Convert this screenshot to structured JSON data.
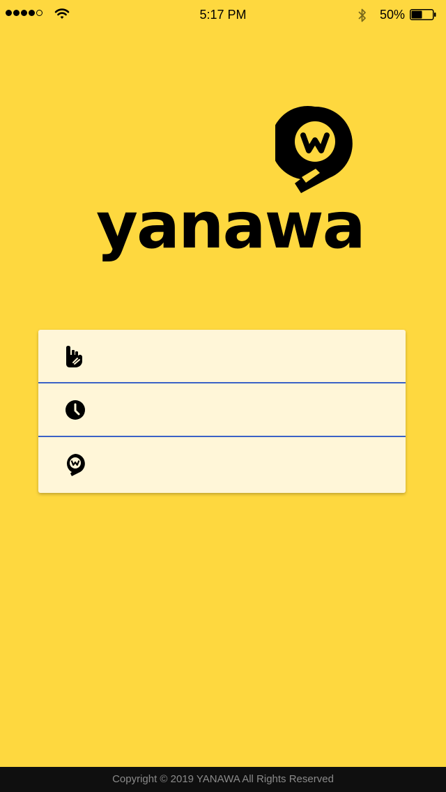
{
  "status_bar": {
    "time": "5:17 PM",
    "battery_percent": "50%",
    "battery_level": 0.5,
    "signal_bars_filled": 4,
    "signal_bars_total": 5
  },
  "brand": {
    "name": "yanawa",
    "logo_letter": "w",
    "color_primary": "#FED83F",
    "color_dark": "#000000"
  },
  "menu": {
    "items": [
      {
        "icon": "hand-gesture-icon",
        "label": ""
      },
      {
        "icon": "clock-icon",
        "label": ""
      },
      {
        "icon": "yanawa-pin-icon",
        "label": ""
      }
    ],
    "divider_color": "#3B62C6"
  },
  "footer": {
    "copyright": "Copyright © 2019 YANAWA All Rights Reserved"
  }
}
